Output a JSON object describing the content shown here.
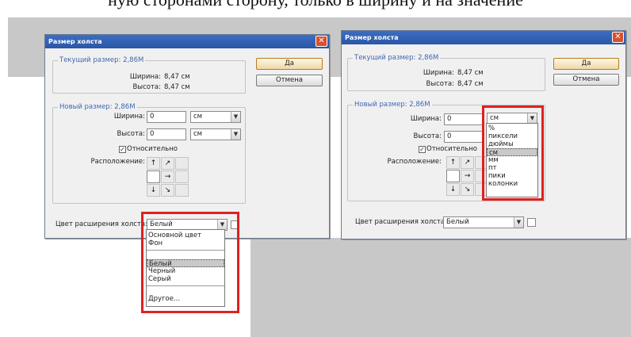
{
  "page": {
    "caption": "ную сторонами сторону, только в ширину и на значение"
  },
  "colors": {
    "accent_red": "#e02020",
    "title_blue": "#2a56a6",
    "legend_blue": "#3f69b2"
  },
  "dialog1": {
    "title": "Размер холста",
    "current_legend": "Текущий размер: 2,86M",
    "width_label": "Ширина:",
    "width_value": "8,47 см",
    "height_label": "Высота:",
    "height_value": "8,47 см",
    "ok_label": "Да",
    "cancel_label": "Отмена",
    "new_legend": "Новый размер: 2,86M",
    "new_width_label": "Ширина:",
    "new_width_value": "0",
    "new_width_unit": "см",
    "new_height_label": "Высота:",
    "new_height_value": "0",
    "new_height_unit": "см",
    "relative_label": "Относительно",
    "anchor_label": "Расположение:",
    "ext_color_label": "Цвет расширения холста:",
    "ext_color_value": "Белый",
    "color_options": [
      "Основной цвет",
      "Фон",
      "Белый",
      "Черный",
      "Серый",
      "Другое..."
    ]
  },
  "dialog2": {
    "title": "Размер холста",
    "current_legend": "Текущий размер: 2,86M",
    "width_label": "Ширина:",
    "width_value": "8,47 см",
    "height_label": "Высота:",
    "height_value": "8,47 см",
    "ok_label": "Да",
    "cancel_label": "Отмена",
    "new_legend": "Новый размер: 2,86M",
    "new_width_label": "Ширина:",
    "new_width_value": "0",
    "new_width_unit": "см",
    "new_height_label": "Высота:",
    "new_height_value": "0",
    "relative_label": "Относительно",
    "anchor_label": "Расположение:",
    "ext_color_label": "Цвет расширения холста:",
    "ext_color_value": "Белый",
    "unit_options": [
      "%",
      "пиксели",
      "дюймы",
      "см",
      "мм",
      "пт",
      "пики",
      "колонки"
    ]
  }
}
